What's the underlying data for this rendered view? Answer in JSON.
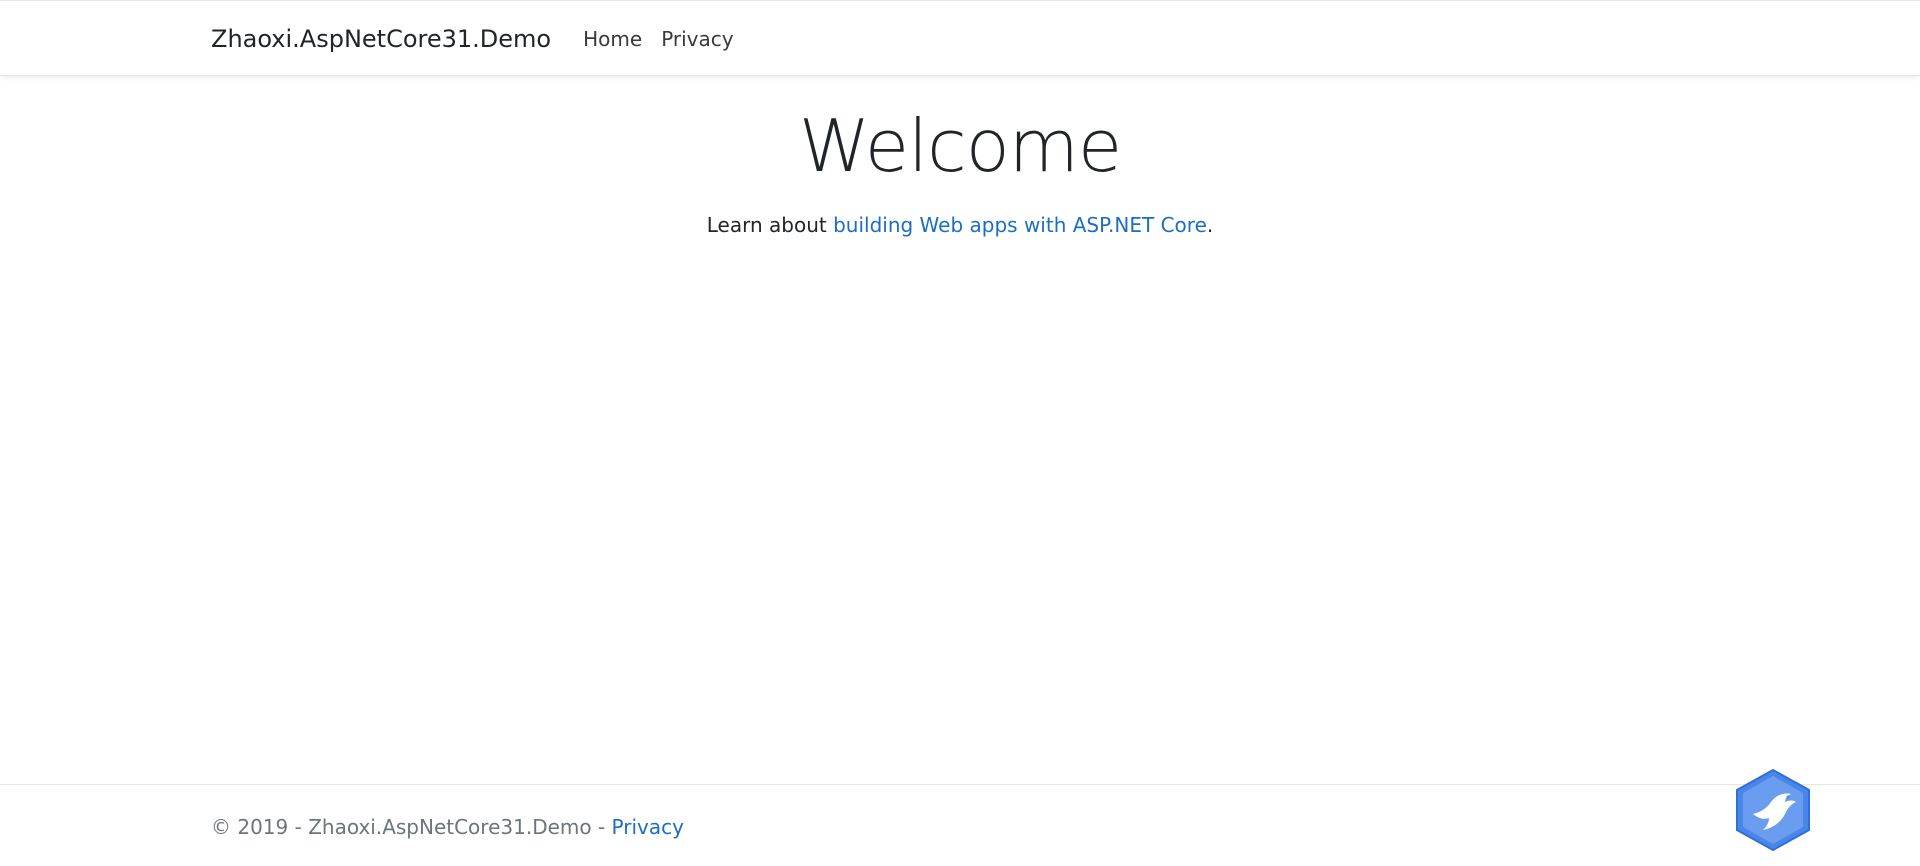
{
  "navbar": {
    "brand": "Zhaoxi.AspNetCore31.Demo",
    "links": [
      {
        "label": "Home"
      },
      {
        "label": "Privacy"
      }
    ]
  },
  "main": {
    "heading": "Welcome",
    "lead_prefix": "Learn about ",
    "lead_link": "building Web apps with ASP.NET Core",
    "lead_suffix": "."
  },
  "footer": {
    "copyright": "© 2019 - Zhaoxi.AspNetCore31.Demo - ",
    "privacy_link": "Privacy"
  },
  "widget": {
    "icon": "bird-hexagon-icon",
    "colors": {
      "hex_outer": "#4a86e8",
      "hex_inner": "#6a9df0",
      "bird": "#ffffff"
    }
  },
  "colors": {
    "link": "#1b6ec2",
    "text": "#212529",
    "muted": "#6c757d",
    "border": "#e5e5e5"
  }
}
